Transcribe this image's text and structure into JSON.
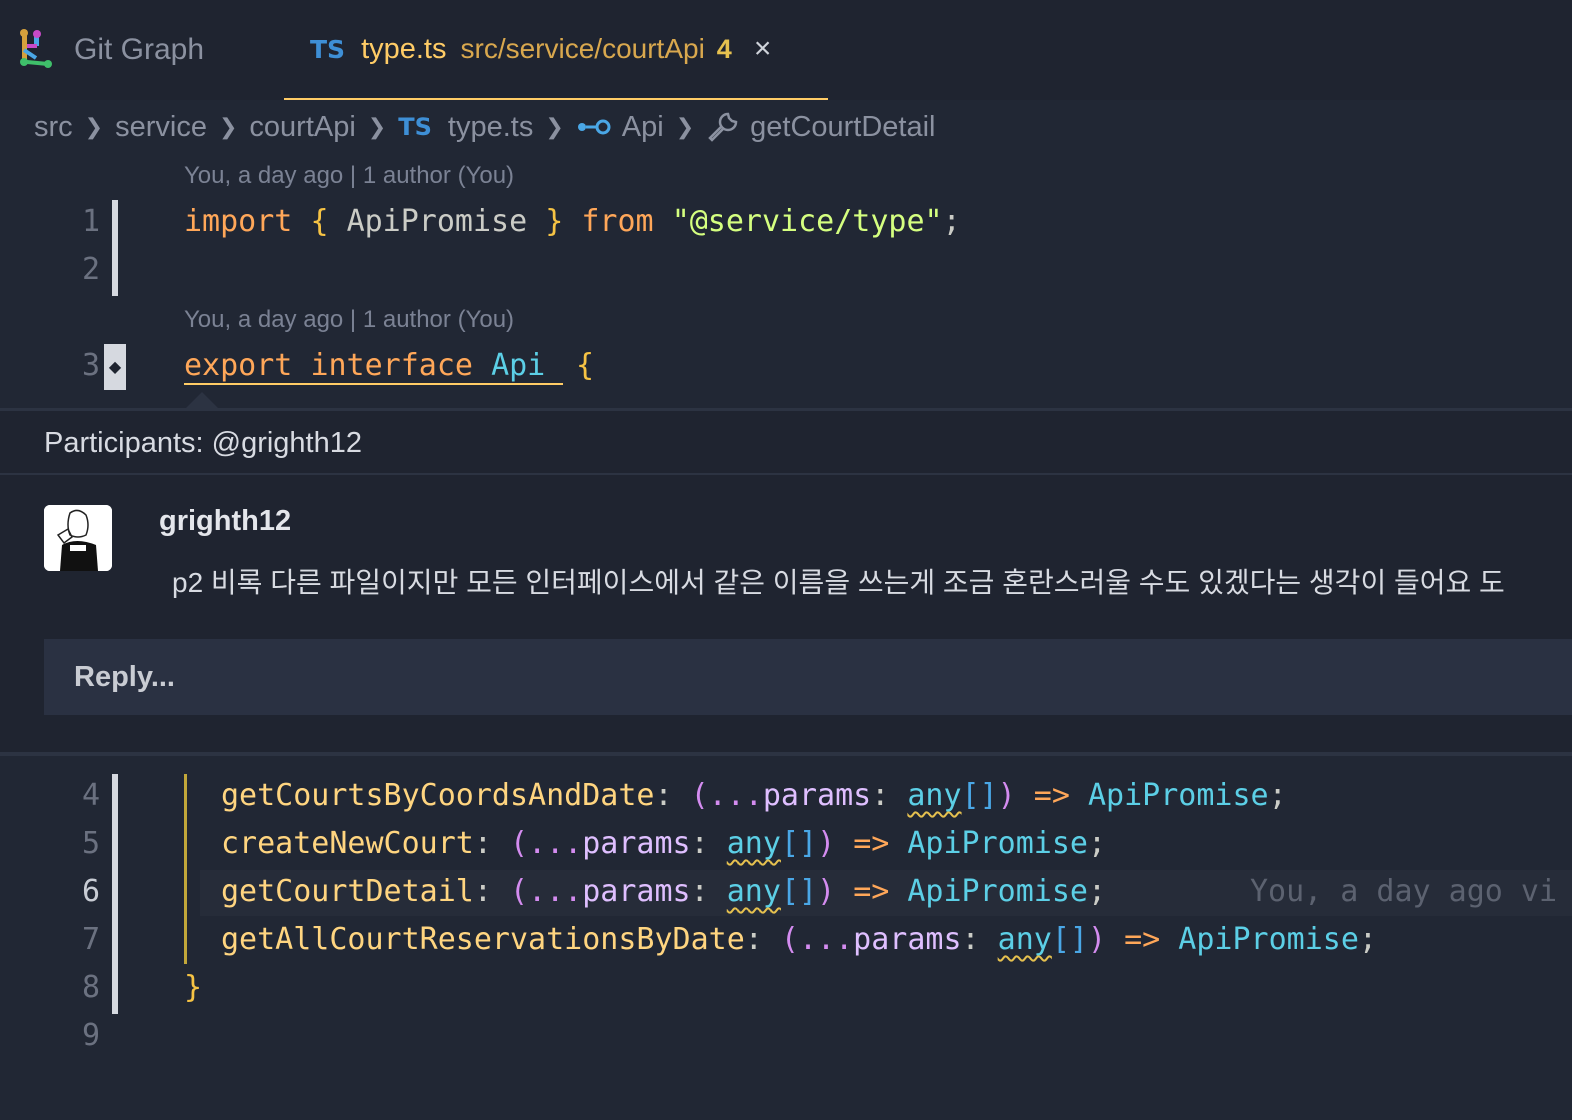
{
  "tabs": {
    "git_graph": {
      "label": "Git Graph"
    },
    "active": {
      "badge": "TS",
      "filename": "type.ts",
      "path": "src/service/courtApi",
      "problems": "4",
      "close": "×"
    }
  },
  "breadcrumb": {
    "items": [
      "src",
      "service",
      "courtApi",
      "type.ts",
      "Api",
      "getCourtDetail"
    ],
    "ts_badge": "TS"
  },
  "editor": {
    "blame_1": "You, a day ago | 1 author (You)",
    "blame_2": "You, a day ago | 1 author (You)",
    "line_numbers": [
      "1",
      "2",
      "3",
      "4",
      "5",
      "6",
      "7",
      "8",
      "9"
    ],
    "line1": {
      "import": "import",
      "open": "{",
      "name": "ApiPromise",
      "close": "}",
      "from": "from",
      "source": "\"@service/type\"",
      "semi": ";"
    },
    "line3": {
      "export": "export",
      "interface": "interface",
      "name": "Api",
      "brace": "{"
    },
    "members": [
      {
        "name": "getCourtsByCoordsAndDate"
      },
      {
        "name": "createNewCourt"
      },
      {
        "name": "getCourtDetail"
      },
      {
        "name": "getAllCourtReservationsByDate"
      }
    ],
    "tokens": {
      "colon": ":",
      "lparen": "(",
      "spread": "...",
      "param": "params",
      "any": "any",
      "arr": "[]",
      "rparen": ")",
      "arrow": "=>",
      "ret": "ApiPromise",
      "semi": ";"
    },
    "inline_blame": "You, a day ago vi",
    "closing_brace": "}"
  },
  "comment": {
    "participants": "Participants: @grighth12",
    "author": "grighth12",
    "body": "p2  비록 다른 파일이지만 모든 인터페이스에서 같은 이름을 쓰는게 조금 혼란스러울 수도 있겠다는 생각이 들어요 도",
    "reply_placeholder": "Reply..."
  }
}
